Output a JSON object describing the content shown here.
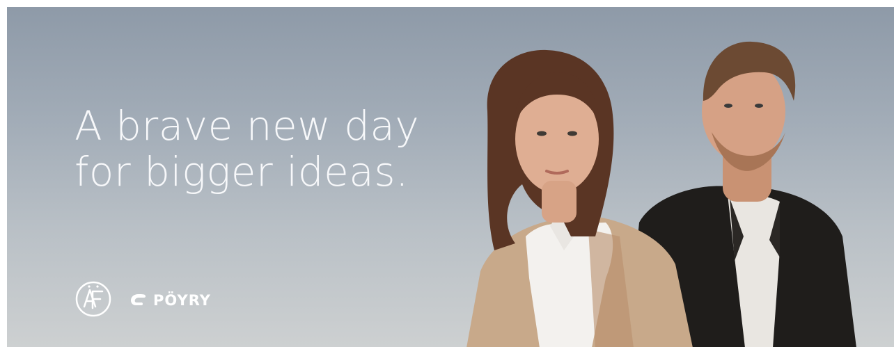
{
  "headline": {
    "line1": "A brave new day",
    "line2": "for bigger ideas."
  },
  "logos": {
    "af_icon": "af-monogram-icon",
    "poyry_icon": "poyry-swirl-icon",
    "poyry_wordmark": "PÖYRY"
  },
  "photo": {
    "subject": "two-people-portrait"
  },
  "colors": {
    "sky_top": "#8e9aa8",
    "sky_bottom": "#cdd0d1",
    "headline_text": "#f7f8fa"
  }
}
